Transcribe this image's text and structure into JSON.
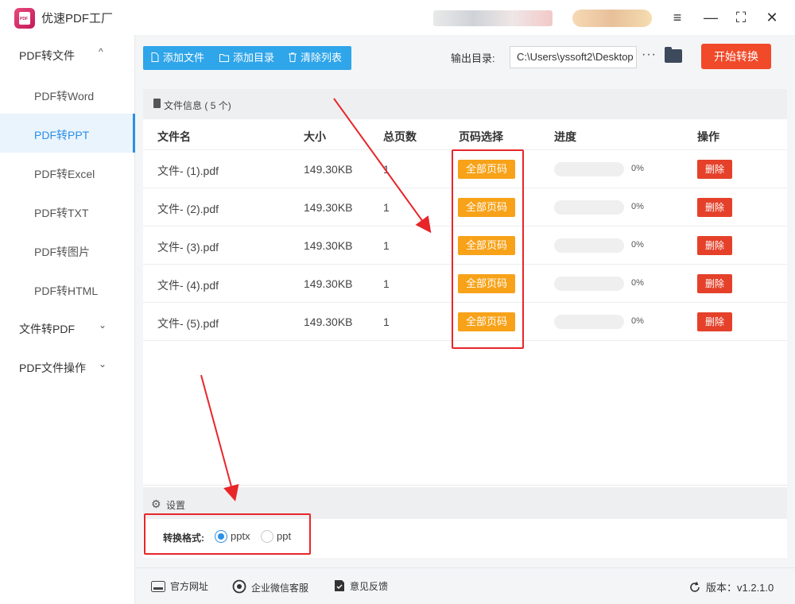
{
  "app": {
    "title": "优速PDF工厂",
    "logo_text": "PDF"
  },
  "sidebar": {
    "groups": [
      {
        "label": "PDF转文件",
        "chevron": "^"
      },
      {
        "label": "文件转PDF",
        "chevron": "⌄"
      },
      {
        "label": "PDF文件操作",
        "chevron": "⌄"
      }
    ],
    "items": [
      "PDF转Word",
      "PDF转PPT",
      "PDF转Excel",
      "PDF转TXT",
      "PDF转图片",
      "PDF转HTML"
    ],
    "active_item": "PDF转PPT"
  },
  "toolbar": {
    "add_file": "添加文件",
    "add_dir": "添加目录",
    "clear_list": "清除列表",
    "output_label": "输出目录:",
    "output_path": "C:\\Users\\yssoft2\\Desktop",
    "more": "···",
    "start": "开始转换"
  },
  "file_panel": {
    "title": "文件信息",
    "count_text": "( 5 个)",
    "columns": [
      "文件名",
      "大小",
      "总页数",
      "页码选择",
      "进度",
      "操作"
    ],
    "rows": [
      {
        "name": "文件- (1).pdf",
        "size": "149.30KB",
        "pages": "1",
        "page_select": "全部页码",
        "progress": 0,
        "progress_text": "0%",
        "action": "删除"
      },
      {
        "name": "文件- (2).pdf",
        "size": "149.30KB",
        "pages": "1",
        "page_select": "全部页码",
        "progress": 0,
        "progress_text": "0%",
        "action": "删除"
      },
      {
        "name": "文件- (3).pdf",
        "size": "149.30KB",
        "pages": "1",
        "page_select": "全部页码",
        "progress": 0,
        "progress_text": "0%",
        "action": "删除"
      },
      {
        "name": "文件- (4).pdf",
        "size": "149.30KB",
        "pages": "1",
        "page_select": "全部页码",
        "progress": 0,
        "progress_text": "0%",
        "action": "删除"
      },
      {
        "name": "文件- (5).pdf",
        "size": "149.30KB",
        "pages": "1",
        "page_select": "全部页码",
        "progress": 0,
        "progress_text": "0%",
        "action": "删除"
      }
    ]
  },
  "settings": {
    "title": "设置",
    "format_label": "转换格式:",
    "options": [
      "pptx",
      "ppt"
    ],
    "selected": "pptx"
  },
  "footer": {
    "website": "官方网址",
    "wechat": "企业微信客服",
    "feedback": "意见反馈",
    "version": "版本：v1.2.1.0"
  },
  "colors": {
    "accent": "#2fa5ea",
    "start": "#f04a2a",
    "page_btn": "#f7a218",
    "delete": "#e5412a",
    "annotation": "#e8262a"
  }
}
